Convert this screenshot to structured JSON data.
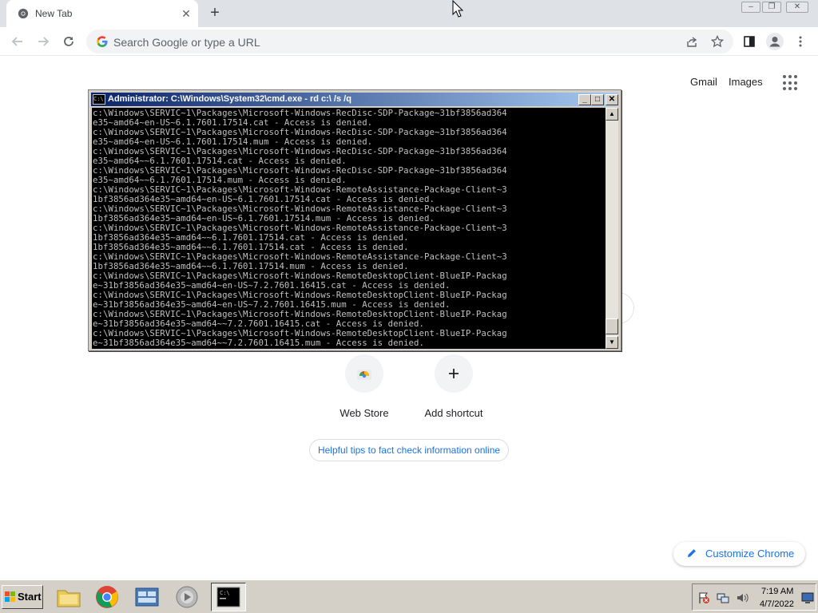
{
  "browser": {
    "tab": {
      "title": "New Tab"
    },
    "omnibox": {
      "placeholder": "Search Google or type a URL"
    },
    "header_links": {
      "gmail": "Gmail",
      "images": "Images"
    },
    "shortcuts": [
      {
        "label": "Web Store",
        "icon": "web-store-icon"
      },
      {
        "label": "Add shortcut",
        "icon": "plus-icon"
      }
    ],
    "tips_chip": "Helpful tips to fact check information online",
    "customize": "Customize Chrome",
    "accent_color": "#1a73e8"
  },
  "cmd_window": {
    "title": "Administrator: C:\\Windows\\System32\\cmd.exe - rd  c:\\ /s /q",
    "lines": [
      "c:\\Windows\\SERVIC~1\\Packages\\Microsoft-Windows-RecDisc-SDP-Package~31bf3856ad364",
      "e35~amd64~en-US~6.1.7601.17514.cat - Access is denied.",
      "c:\\Windows\\SERVIC~1\\Packages\\Microsoft-Windows-RecDisc-SDP-Package~31bf3856ad364",
      "e35~amd64~en-US~6.1.7601.17514.mum - Access is denied.",
      "c:\\Windows\\SERVIC~1\\Packages\\Microsoft-Windows-RecDisc-SDP-Package~31bf3856ad364",
      "e35~amd64~~6.1.7601.17514.cat - Access is denied.",
      "c:\\Windows\\SERVIC~1\\Packages\\Microsoft-Windows-RecDisc-SDP-Package~31bf3856ad364",
      "e35~amd64~~6.1.7601.17514.mum - Access is denied.",
      "c:\\Windows\\SERVIC~1\\Packages\\Microsoft-Windows-RemoteAssistance-Package-Client~3",
      "1bf3856ad364e35~amd64~en-US~6.1.7601.17514.cat - Access is denied.",
      "c:\\Windows\\SERVIC~1\\Packages\\Microsoft-Windows-RemoteAssistance-Package-Client~3",
      "1bf3856ad364e35~amd64~en-US~6.1.7601.17514.mum - Access is denied.",
      "c:\\Windows\\SERVIC~1\\Packages\\Microsoft-Windows-RemoteAssistance-Package-Client~3",
      "1bf3856ad364e35~amd64~~6.1.7601.17514.cat - Access is denied.",
      "1bf3856ad364e35~amd64~~6.1.7601.17514.cat - Access is denied.",
      "c:\\Windows\\SERVIC~1\\Packages\\Microsoft-Windows-RemoteAssistance-Package-Client~3",
      "1bf3856ad364e35~amd64~~6.1.7601.17514.mum - Access is denied.",
      "c:\\Windows\\SERVIC~1\\Packages\\Microsoft-Windows-RemoteDesktopClient-BlueIP-Packag",
      "e~31bf3856ad364e35~amd64~en-US~7.2.7601.16415.cat - Access is denied.",
      "c:\\Windows\\SERVIC~1\\Packages\\Microsoft-Windows-RemoteDesktopClient-BlueIP-Packag",
      "e~31bf3856ad364e35~amd64~en-US~7.2.7601.16415.mum - Access is denied.",
      "c:\\Windows\\SERVIC~1\\Packages\\Microsoft-Windows-RemoteDesktopClient-BlueIP-Packag",
      "e~31bf3856ad364e35~amd64~~7.2.7601.16415.cat - Access is denied.",
      "c:\\Windows\\SERVIC~1\\Packages\\Microsoft-Windows-RemoteDesktopClient-BlueIP-Packag",
      "e~31bf3856ad364e35~amd64~~7.2.7601.16415.mum - Access is denied."
    ]
  },
  "taskbar": {
    "start_label": "Start",
    "apps": [
      {
        "name": "explorer-icon",
        "active": false
      },
      {
        "name": "chrome-icon",
        "active": false
      },
      {
        "name": "server-manager-icon",
        "active": false
      },
      {
        "name": "media-icon",
        "active": false
      },
      {
        "name": "cmd-icon",
        "active": true
      }
    ],
    "clock": {
      "time": "7:19 AM",
      "date": "4/7/2022"
    }
  }
}
